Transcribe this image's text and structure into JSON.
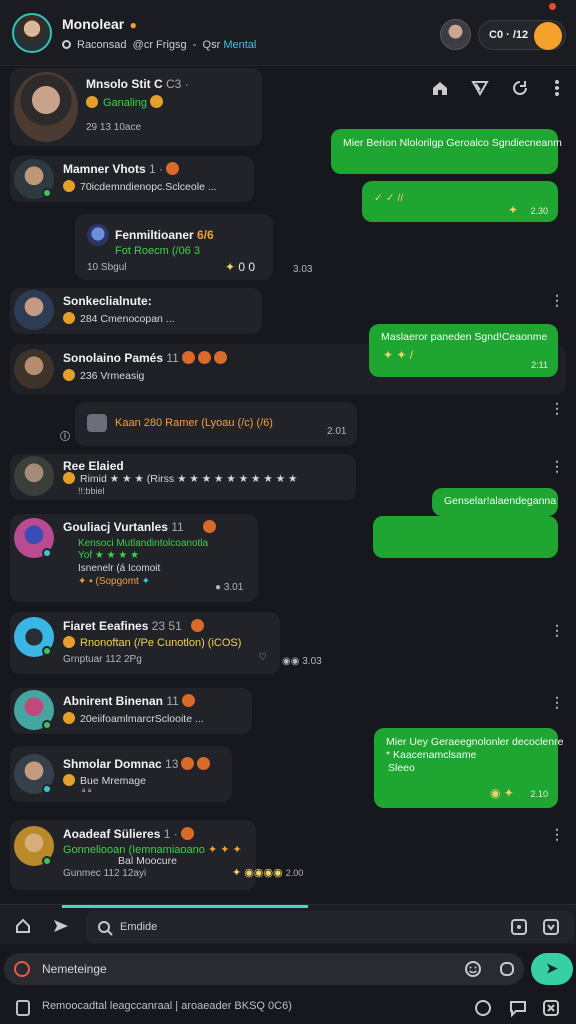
{
  "header": {
    "title": "Monolear",
    "subtitle_a": "Raconsad",
    "subtitle_b": "@cr Frigsg",
    "subtitle_sep": "-",
    "subtitle_c": "Qsr",
    "subtitle_accent": "Mental",
    "pill_text": "C0 · /12"
  },
  "toolbar": {
    "icons": [
      "home-icon",
      "send-icon",
      "refresh-icon",
      "more-icon"
    ]
  },
  "conversations": [
    {
      "name": "Mnsolo Stit C",
      "suffix": "C3 ·",
      "tag": "Ganaling",
      "meta": "29 13 10ace"
    },
    {
      "name": "Mamner Vhots",
      "suffix": "1 ·",
      "tag": "",
      "preview": "70icdemndienopc.Sclceole ...",
      "meta": ""
    },
    {
      "name": "Fenmiltioaner",
      "suffix": "6/6",
      "tag": "Fot Roecm (/06 3",
      "preview": "",
      "meta": "10 Sbgul",
      "reactions": "0 0",
      "time": "3.03"
    },
    {
      "name": "Sonkeclialnute:",
      "suffix": "",
      "tag": "",
      "preview": "284 Cmenocopan ...",
      "meta": ""
    },
    {
      "name": "Sonolaino Pamés",
      "suffix": "11",
      "tag": "",
      "preview": "236 Vrmeasig",
      "meta": ""
    },
    {
      "name": "",
      "suffix": "",
      "tag": "Kaan 280 Ramer (Lyoau (/c) (/6)",
      "preview": "",
      "meta": "",
      "time": "2.01"
    },
    {
      "name": "Ree Elaied",
      "suffix": "",
      "tag": "",
      "preview": "Rimid ★ ★ ★ (Rirss ★ ★ ★ ★ ★ ★ ★ ★ ★ ★",
      "meta": "!!:bbiel"
    },
    {
      "name": "Gouliacj Vurtanles",
      "suffix": "11",
      "tag": "Kensoci Mutlandintolcoanotla",
      "tag2": "Yof ★ ★ ★ ★",
      "preview": "Isnenelr (á Icomoit",
      "tag3": "(Sopgomt",
      "time": "3.01"
    },
    {
      "name": "Fiaret Eeafines",
      "suffix": "23 51",
      "tag": "Rnonoftan (/Pe Cunotlon) (iCOS)",
      "preview": "Grnptuar 112 2Pg",
      "meta": "",
      "time": "3.03"
    },
    {
      "name": "Abnirent Binenan",
      "suffix": "11",
      "tag": "",
      "preview": "20eiifoamlmarcrSclooite ...",
      "meta": ""
    },
    {
      "name": "Shmolar Domnac",
      "suffix": "13",
      "tag": "",
      "preview": "Bue Mremage",
      "meta": "ª ª"
    },
    {
      "name": "Aoadeaf Sülieres",
      "suffix": "1 ·",
      "tag": "Gonneliooan (Iemnamiaoano",
      "preview": "Bal Moocure",
      "meta": "Gunmec 112 12ayi",
      "time": "2.00"
    }
  ],
  "bubbles": [
    {
      "text": "Mier Berion Nlolorilgp Geroalco Sgndiecneanm",
      "time": ""
    },
    {
      "text": "✓ ✓ //",
      "time": "2.30"
    },
    {
      "text": "Maslaeror paneden Sgnd!Ceaonme",
      "time": "2:11"
    },
    {
      "text": "Genselar!alaendeganna",
      "time": ""
    },
    {
      "text": "",
      "time": ""
    },
    {
      "text": "Mier Uey Geraeegnolonler decoclenre",
      "text2": "* Kaacenamclsame",
      "text3": "Sleeo",
      "time": "2.10"
    }
  ],
  "bottom": {
    "search_label": "Emdide",
    "compose_placeholder": "Nemeteinge",
    "footer_text": "Remoocadtal leagccanraal | aroaeader BKSQ 0C6)"
  },
  "colors": {
    "accent_green": "#1fa532",
    "accent_teal": "#38cfa6",
    "highlight_orange": "#f6a22a",
    "background": "#17181d"
  }
}
